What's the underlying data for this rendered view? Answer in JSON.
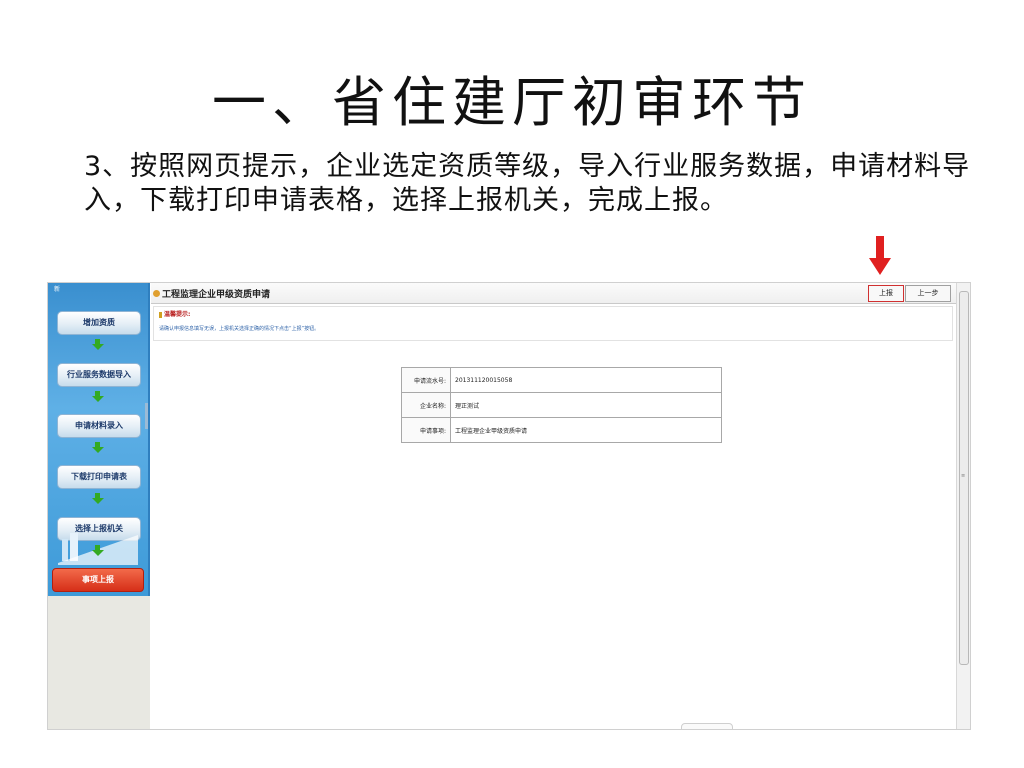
{
  "slide": {
    "title": "一、省住建厅初审环节",
    "description": "3、按照网页提示，企业选定资质等级，导入行业服务数据，申请材料导入，下载打印申请表格，选择上报机关，完成上报。"
  },
  "sidebar": {
    "logo_text": "新",
    "steps": [
      {
        "label": "增加资质"
      },
      {
        "label": "行业服务数据导入"
      },
      {
        "label": "申请材料录入"
      },
      {
        "label": "下载打印申请表"
      },
      {
        "label": "选择上报机关"
      }
    ],
    "submit_label": "事项上报"
  },
  "header": {
    "title": "工程监理企业甲级资质申请",
    "report_button": "上报",
    "prev_button": "上一步"
  },
  "tip": {
    "label": "温馨提示:",
    "text": "请确认申报信息填写无误，上报机关选择正确的情况下点击“上报”按钮。"
  },
  "info_table": {
    "rows": [
      {
        "label": "申请流水号:",
        "value": "201311120015058"
      },
      {
        "label": "企业名称:",
        "value": "理正测试"
      },
      {
        "label": "申请事项:",
        "value": "工程监理企业甲级资质申请"
      }
    ]
  },
  "colors": {
    "arrow_red": "#e02020",
    "sidebar_blue": "#3d9ad8",
    "step_arrow_green": "#33aa22",
    "submit_red": "#d62f18"
  }
}
